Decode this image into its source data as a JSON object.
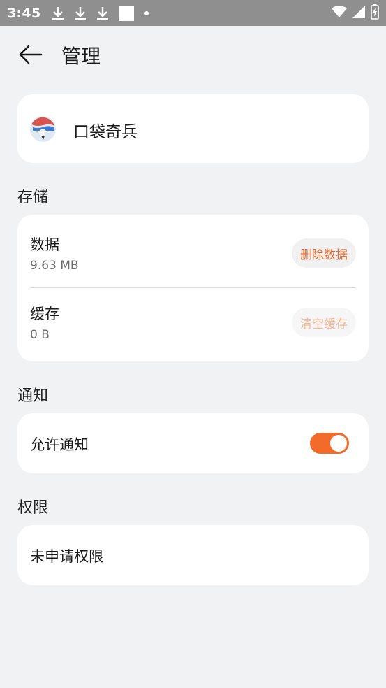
{
  "status_bar": {
    "time": "3:45",
    "left_icons": [
      "download-icon",
      "download-icon",
      "download-icon",
      "square-icon",
      "dot-icon"
    ],
    "right_icons": [
      "wifi-icon",
      "signal-icon",
      "battery-icon"
    ]
  },
  "header": {
    "back_icon": "back-arrow-icon",
    "title": "管理"
  },
  "app": {
    "icon": "app-icon",
    "name": "口袋奇兵"
  },
  "storage": {
    "section_label": "存储",
    "data": {
      "title": "数据",
      "size": "9.63 MB",
      "button": "删除数据"
    },
    "cache": {
      "title": "缓存",
      "size": "0 B",
      "button": "清空缓存"
    }
  },
  "notification": {
    "section_label": "通知",
    "allow_label": "允许通知",
    "enabled": true
  },
  "permissions": {
    "section_label": "权限",
    "value": "未申请权限"
  },
  "colors": {
    "accent": "#f26b2a",
    "background": "#f1f2f4",
    "card": "#ffffff",
    "status_bar": "#8f8f8f"
  }
}
